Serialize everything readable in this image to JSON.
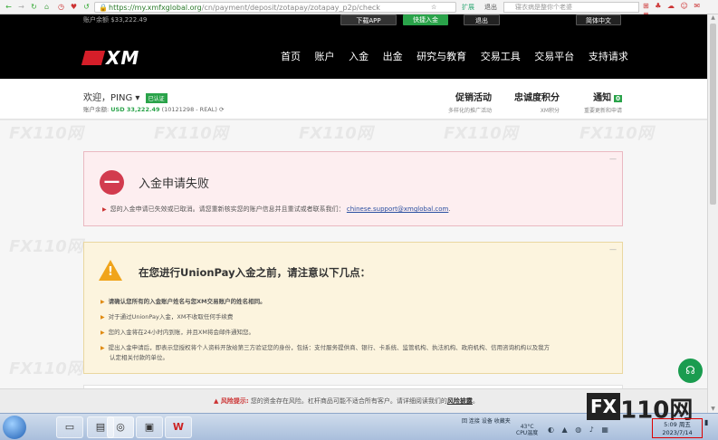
{
  "browser": {
    "url_host": "https://my.xmfxglobal.org",
    "url_path": "/cn/payment/deposit/zotapay/zotapay_p2p/check",
    "search_placeholder": "寝衣病是整你个老婆",
    "tool_back": "退出",
    "tool_ext": "扩展",
    "tool_sep": "|"
  },
  "header": {
    "top_left": "账户余额 $33,222.49",
    "download_label": "下载APP",
    "deposit_label": "快捷入金",
    "logout_label": "退出",
    "language_label": "简体中文",
    "logo_text": "XM",
    "nav": [
      "首页",
      "账户",
      "入金",
      "出金",
      "研究与教育",
      "交易工具",
      "交易平台",
      "支持请求"
    ]
  },
  "user": {
    "welcome": "欢迎，PING",
    "verified_badge": "已认证",
    "balance_label": "账户余额:",
    "balance_value": "USD 33,222.49",
    "account_info": "(10121298 - REAL)",
    "promo_title": "促销活动",
    "promo_sub": "多样化的推广活动",
    "loyalty_title": "忠诚度积分",
    "loyalty_sub": "XM积分",
    "notice_title": "通知",
    "notice_count": "0",
    "notice_sub": "重要更新和申请"
  },
  "error": {
    "title": "入金申请失败",
    "message": "您的入金申请已失效或已取消。请您重新核实您的账户信息并且重试或者联系我们：",
    "email": "chinese.support@xmglobal.com",
    "message_end": "."
  },
  "warning": {
    "title": "在您进行UnionPay入金之前，请注意以下几点：",
    "items": [
      "请确认您所有的入金账户姓名与您XM交易账户的姓名相同。",
      "对于通过UnionPay入金，XM不收取任何手续费",
      "您的入金将在24小时内到账，并且XM将会邮件通知您。",
      "提出入金申请后，即表示您授权将个人资料开放给第三方验证您的身份，包括：支付服务提供商、银行、卡系统、监管机构、执法机构、政府机构、信用咨询机构以及我方",
      "认定相关付款的单位。"
    ]
  },
  "risk": {
    "label": "风险提示:",
    "text": "您的资金存在风险。杠杆商品可能不适合所有客户。请详细阅读我们的",
    "link": "风险披露",
    "end": "。"
  },
  "taskbar": {
    "tray_text": "回 连接   设备   收藏夹",
    "temp": "43°C",
    "temp_label": "CPU温度",
    "time": "5:09 周五",
    "date": "2023/7/14"
  },
  "watermark": {
    "brand": "FX110网",
    "fx": "FX",
    "num": "110网"
  }
}
